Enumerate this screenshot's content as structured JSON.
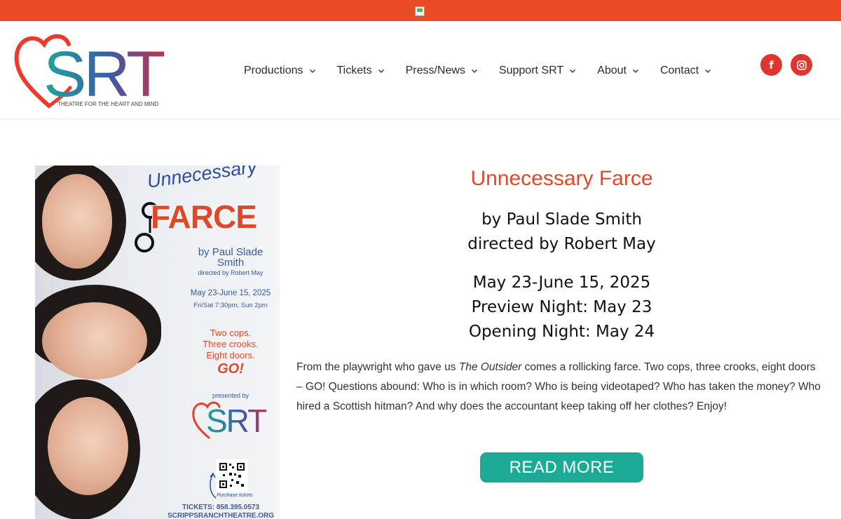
{
  "topbar": {
    "image_alt": ""
  },
  "logo": {
    "letters": "SRT",
    "tagline": "THEATRE FOR THE HEART AND MIND"
  },
  "nav": {
    "items": [
      {
        "label": "Productions"
      },
      {
        "label": "Tickets"
      },
      {
        "label": "Press/News"
      },
      {
        "label": "Support SRT"
      },
      {
        "label": "About"
      },
      {
        "label": "Contact"
      }
    ]
  },
  "social": {
    "facebook_glyph": "f",
    "instagram_icon": "instagram-icon"
  },
  "poster": {
    "title_line1": "Unnecessary",
    "title_line2": "FARCE",
    "author_line1": "by Paul Slade",
    "author_line2": "Smith",
    "director": "directed by Robert May",
    "dates": "May 23-June 15, 2025",
    "times": "Fri/Sat 7:30pm, Sun 2pm",
    "tag1": "Two cops.",
    "tag2": "Three crooks.",
    "tag3": "Eight doors.",
    "tag4": "GO!",
    "presented_by": "presented by",
    "logo_letters": "SRT",
    "purchase": "Purchase tickets",
    "tickets": "TICKETS: 858.395.0573",
    "website": "SCRIPPSRANCHTHEATRE.ORG",
    "colors": {
      "accent": "#e0482a",
      "blue": "#3b5ba0"
    }
  },
  "show": {
    "title": "Unnecessary Farce",
    "author": "by Paul Slade Smith",
    "director": "directed by Robert May",
    "run_dates": "May 23-June 15, 2025",
    "preview": "Preview Night: May 23",
    "opening": "Opening Night: May 24",
    "desc_before": "From the playwright who gave us ",
    "desc_em": "The Outsider",
    "desc_after": " comes a rollicking farce. Two cops, three crooks, eight doors – GO! Questions abound: Who is in which room? Who is being videotaped? Who has taken the money? Who hired a Scottish hitman? And why does the accountant keep taking off her clothes? Enjoy!",
    "button": "READ MORE"
  },
  "colors": {
    "topbar": "#ea4a24",
    "title": "#e0482a",
    "button": "#1aaa96",
    "social": "#e0352f"
  }
}
